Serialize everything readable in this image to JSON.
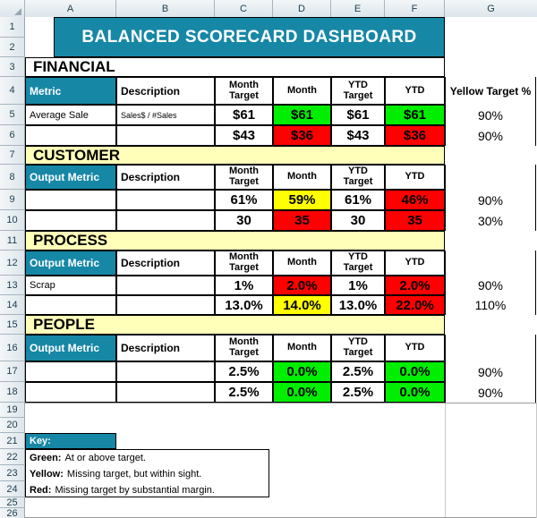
{
  "app": {
    "title": "BALANCED SCORECARD DASHBOARD"
  },
  "grid": {
    "columns": [
      "A",
      "B",
      "C",
      "D",
      "E",
      "F",
      "G"
    ],
    "rows": [
      "1",
      "2",
      "3",
      "4",
      "5",
      "6",
      "7",
      "8",
      "9",
      "10",
      "11",
      "12",
      "13",
      "14",
      "15",
      "16",
      "17",
      "18",
      "19",
      "20",
      "21",
      "22",
      "23",
      "24",
      "25",
      "26"
    ]
  },
  "table_headers": {
    "metric": "Metric",
    "output_metric": "Output Metric",
    "description": "Description",
    "month_target": "Month\nTarget",
    "month_target_l1": "Month",
    "month_target_l2": "Target",
    "month": "Month",
    "ytd_target_l1": "YTD",
    "ytd_target_l2": "Target",
    "ytd": "YTD",
    "yellow_target_pct": "Yellow Target %"
  },
  "sections": [
    {
      "name": "FINANCIAL",
      "section_row": "3",
      "header_row": "4",
      "metric_col_label": "Metric",
      "rows": [
        {
          "row": "5",
          "metric": "Average Sale",
          "description": "Sales$ / #Sales",
          "month_target": "$61",
          "month": "$61",
          "month_status": "green",
          "ytd_target": "$61",
          "ytd": "$61",
          "ytd_status": "green",
          "yellow_target": "90%"
        },
        {
          "row": "6",
          "metric": "",
          "description": "",
          "month_target": "$43",
          "month": "$36",
          "month_status": "red",
          "ytd_target": "$43",
          "ytd": "$36",
          "ytd_status": "red",
          "yellow_target": "90%"
        }
      ]
    },
    {
      "name": "CUSTOMER",
      "section_row": "7",
      "header_row": "8",
      "metric_col_label": "Output Metric",
      "rows": [
        {
          "row": "9",
          "metric": "",
          "description": "",
          "month_target": "61%",
          "month": "59%",
          "month_status": "yellow",
          "ytd_target": "61%",
          "ytd": "46%",
          "ytd_status": "red",
          "yellow_target": "90%"
        },
        {
          "row": "10",
          "metric": "",
          "description": "",
          "month_target": "30",
          "month": "35",
          "month_status": "red",
          "ytd_target": "30",
          "ytd": "35",
          "ytd_status": "red",
          "yellow_target": "30%"
        }
      ]
    },
    {
      "name": "PROCESS",
      "section_row": "11",
      "header_row": "12",
      "metric_col_label": "Output Metric",
      "rows": [
        {
          "row": "13",
          "metric": "Scrap",
          "description": "",
          "month_target": "1%",
          "month": "2.0%",
          "month_status": "red",
          "ytd_target": "1%",
          "ytd": "2.0%",
          "ytd_status": "red",
          "yellow_target": "90%"
        },
        {
          "row": "14",
          "metric": "",
          "description": "",
          "month_target": "13.0%",
          "month": "14.0%",
          "month_status": "yellow",
          "ytd_target": "13.0%",
          "ytd": "22.0%",
          "ytd_status": "red",
          "yellow_target": "110%"
        }
      ]
    },
    {
      "name": "PEOPLE",
      "section_row": "15",
      "header_row": "16",
      "metric_col_label": "Output Metric",
      "rows": [
        {
          "row": "17",
          "metric": "",
          "description": "",
          "month_target": "2.5%",
          "month": "0.0%",
          "month_status": "green",
          "ytd_target": "2.5%",
          "ytd": "0.0%",
          "ytd_status": "green",
          "yellow_target": "90%"
        },
        {
          "row": "18",
          "metric": "",
          "description": "",
          "month_target": "2.5%",
          "month": "0.0%",
          "month_status": "green",
          "ytd_target": "2.5%",
          "ytd": "0.0%",
          "ytd_status": "green",
          "yellow_target": "90%"
        }
      ]
    }
  ],
  "key": {
    "title": "Key:",
    "entries": [
      {
        "label": "Green:",
        "text": "At or above target."
      },
      {
        "label": "Yellow:",
        "text": "Missing target, but within sight."
      },
      {
        "label": "Red:",
        "text": "Missing target by substantial margin."
      }
    ]
  },
  "colors": {
    "brand_teal": "#1787a6",
    "section_band": "#ffffb9",
    "status_green": "#00ee00",
    "status_yellow": "#ffff00",
    "status_red": "#ff0000"
  }
}
